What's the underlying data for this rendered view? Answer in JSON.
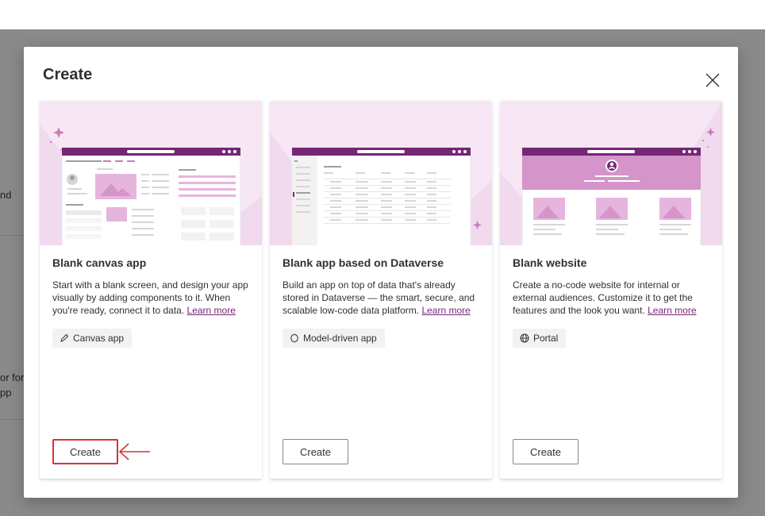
{
  "background": {
    "fragment_1": "nd",
    "fragment_2": "or forr",
    "fragment_3": "pp"
  },
  "dialog": {
    "title": "Create",
    "close_icon": "close-icon"
  },
  "cards": [
    {
      "title": "Blank canvas app",
      "description": "Start with a blank screen, and design your app visually by adding components to it. When you're ready, connect it to data.",
      "learn_more": "Learn more",
      "tag_icon": "pencil-icon",
      "tag_label": "Canvas app",
      "button_label": "Create"
    },
    {
      "title": "Blank app based on Dataverse",
      "description": "Build an app on top of data that's already stored in Dataverse — the smart, secure, and scalable low-code data platform.",
      "learn_more": "Learn more",
      "tag_icon": "model-driven-icon",
      "tag_label": "Model-driven app",
      "button_label": "Create"
    },
    {
      "title": "Blank website",
      "description": "Create a no-code website for internal or external audiences. Customize it to get the features and the look you want.",
      "learn_more": "Learn more",
      "tag_icon": "globe-icon",
      "tag_label": "Portal",
      "button_label": "Create"
    }
  ],
  "colors": {
    "brand_purple": "#742774",
    "hero_background": "#f7e7f4",
    "annotation_red": "#d13438"
  }
}
